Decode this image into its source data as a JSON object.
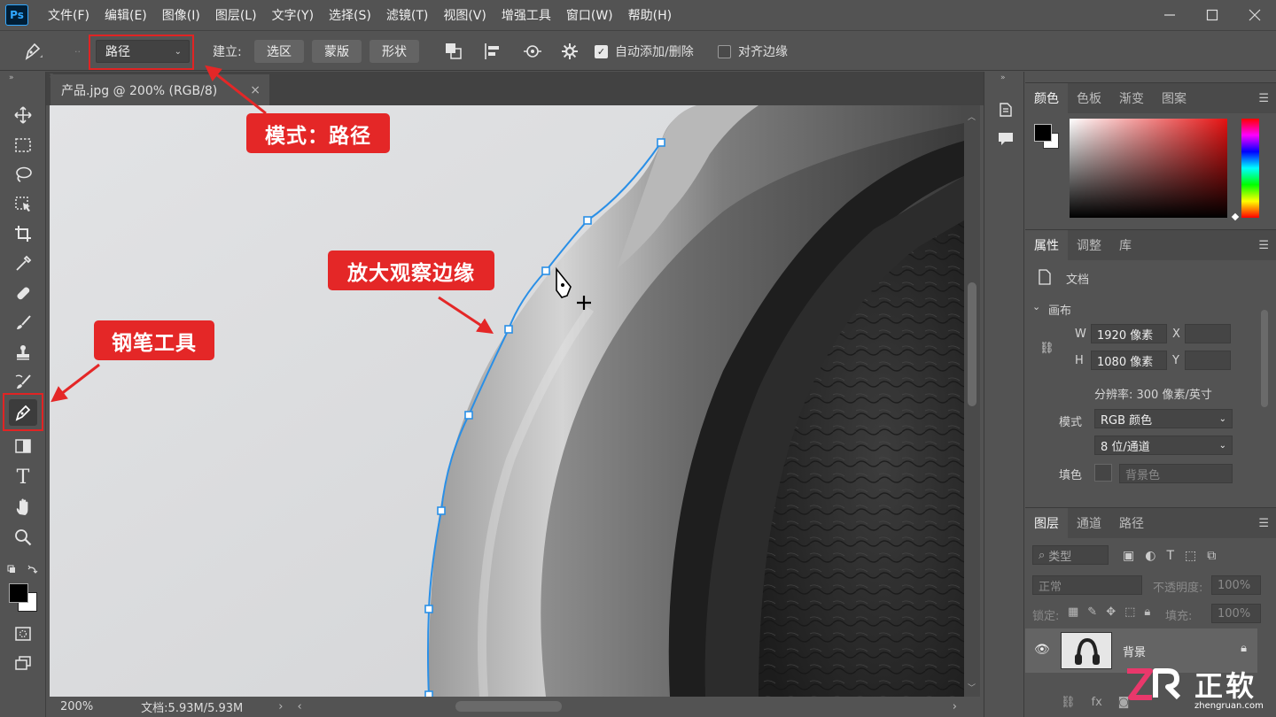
{
  "app": {
    "logo": "Ps",
    "menu": [
      "文件(F)",
      "编辑(E)",
      "图像(I)",
      "图层(L)",
      "文字(Y)",
      "选择(S)",
      "滤镜(T)",
      "视图(V)",
      "增强工具",
      "窗口(W)",
      "帮助(H)"
    ]
  },
  "options": {
    "mode": "路径",
    "build_label": "建立:",
    "btn_selection": "选区",
    "btn_mask": "蒙版",
    "btn_shape": "形状",
    "auto_add_delete": "自动添加/删除",
    "align_edges": "对齐边缘"
  },
  "document": {
    "tab_title": "产品.jpg @ 200% (RGB/8)",
    "zoom": "200%",
    "doc_size": "文档:5.93M/5.93M"
  },
  "color_panel": {
    "tabs": [
      "颜色",
      "色板",
      "渐变",
      "图案"
    ]
  },
  "properties_panel": {
    "tabs": [
      "属性",
      "调整",
      "库"
    ],
    "doc_label": "文档",
    "canvas_section": "画布",
    "w_label": "W",
    "w_value": "1920 像素",
    "h_label": "H",
    "h_value": "1080 像素",
    "x_label": "X",
    "y_label": "Y",
    "resolution": "分辨率: 300 像素/英寸",
    "mode_label": "模式",
    "mode_value": "RGB 颜色",
    "depth_value": "8 位/通道",
    "fill_label": "填色",
    "fill_value": "背景色"
  },
  "layers_panel": {
    "tabs": [
      "图层",
      "通道",
      "路径"
    ],
    "filter_kind": "类型",
    "blend_mode": "正常",
    "opacity_label": "不透明度:",
    "opacity_value": "100%",
    "lock_label": "锁定:",
    "fill_label": "填充:",
    "fill_value": "100%",
    "layer_name": "背景"
  },
  "annotations": {
    "mode_callout": "模式：路径",
    "zoom_callout": "放大观察边缘",
    "pen_callout": "钢笔工具"
  },
  "watermark": {
    "brand": "正软",
    "url": "zhengruan.com"
  },
  "colors": {
    "accent_red": "#e42727",
    "path_blue": "#2a8fe6",
    "ui_gray": "#535353"
  }
}
